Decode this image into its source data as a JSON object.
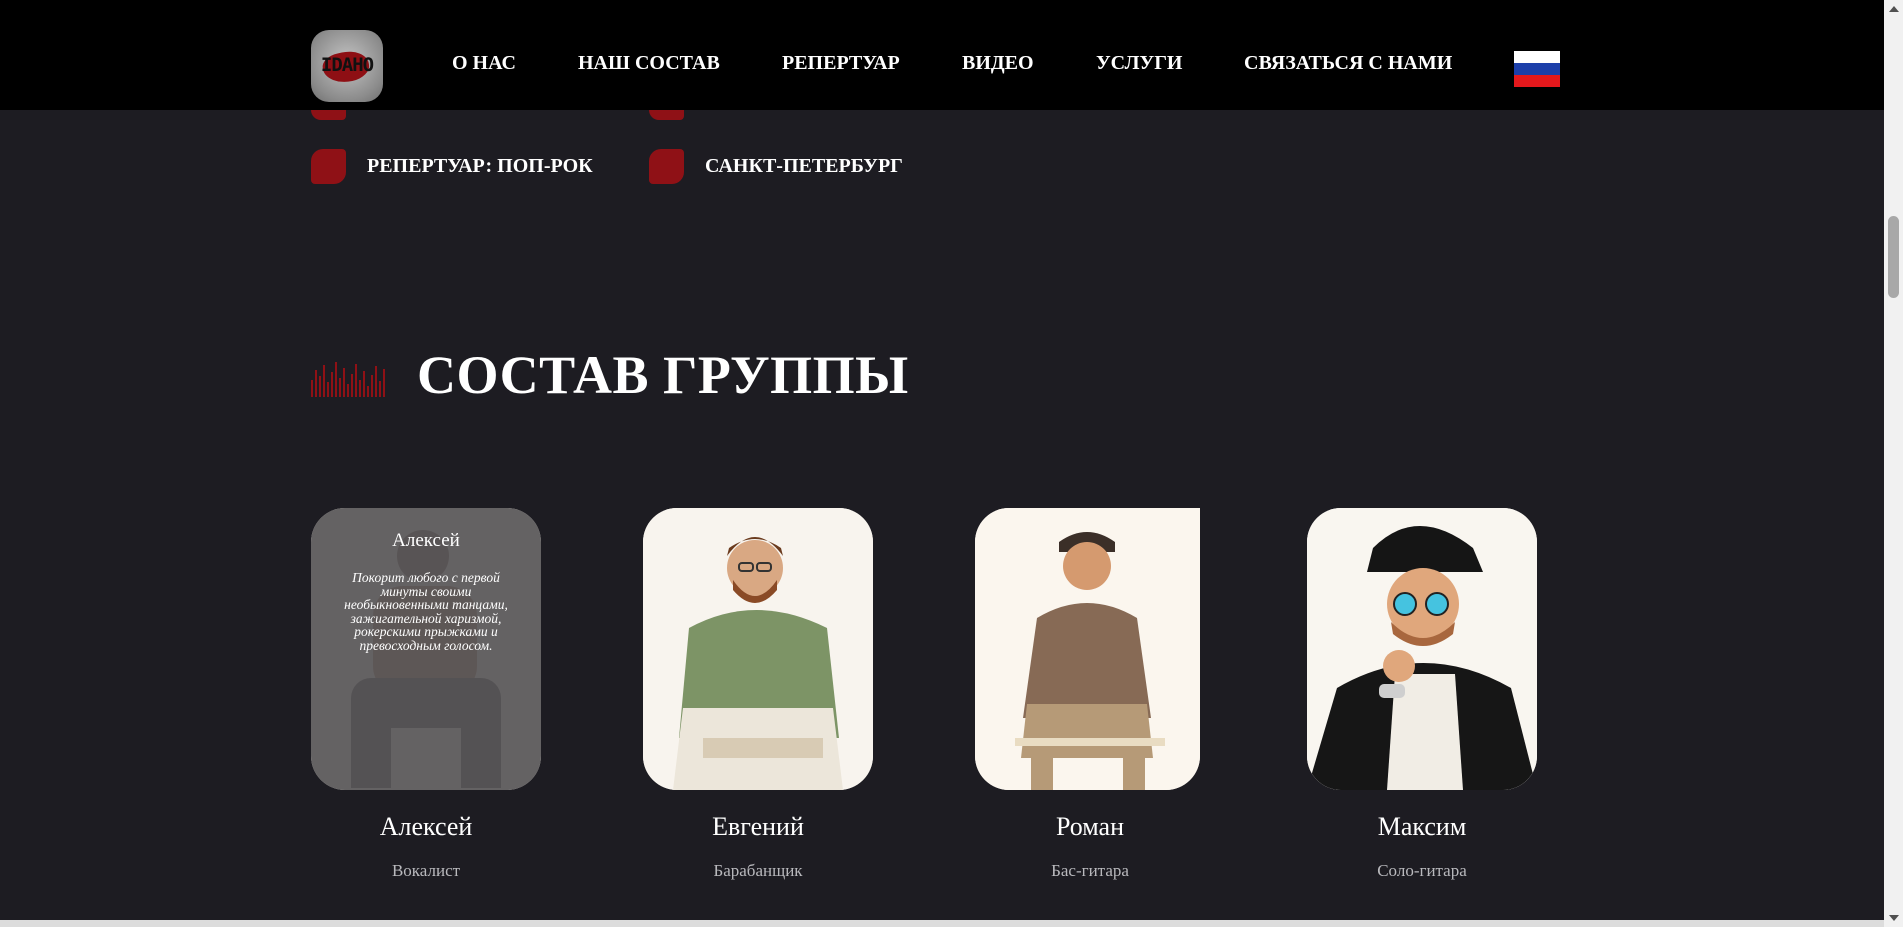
{
  "header": {
    "logo_text": "IDAHO",
    "nav": [
      {
        "label": "О НАС"
      },
      {
        "label": "НАШ СОСТАВ"
      },
      {
        "label": "РЕПЕРТУАР"
      },
      {
        "label": "ВИДЕО"
      },
      {
        "label": "УСЛУГИ"
      },
      {
        "label": "СВЯЗАТЬСЯ С НАМИ"
      }
    ],
    "language": "ru",
    "flag_colors": [
      "#ffffff",
      "#1c3faa",
      "#e4181c"
    ]
  },
  "facts": [
    {
      "text": "РЕПЕРТУАР: ПОП-РОК"
    },
    {
      "text": "САНКТ-ПЕТЕРБУРГ"
    }
  ],
  "section": {
    "title": "СОСТАВ ГРУППЫ"
  },
  "members": [
    {
      "name": "Алексей",
      "role": "Вокалист",
      "hover_name": "Алексей",
      "description": "Покорит любого с первой минуты своими необыкновенными танцами, зажигательной харизмой, рокерскими прыжками и превосходным голосом."
    },
    {
      "name": "Евгений",
      "role": "Барабанщик"
    },
    {
      "name": "Роман",
      "role": "Бас-гитара"
    },
    {
      "name": "Максим",
      "role": "Соло-гитара"
    }
  ],
  "colors": {
    "background": "#1d1c22",
    "header": "#000000",
    "accent": "#8f1116",
    "text": "#ffffff",
    "muted": "#b9b9bd"
  }
}
